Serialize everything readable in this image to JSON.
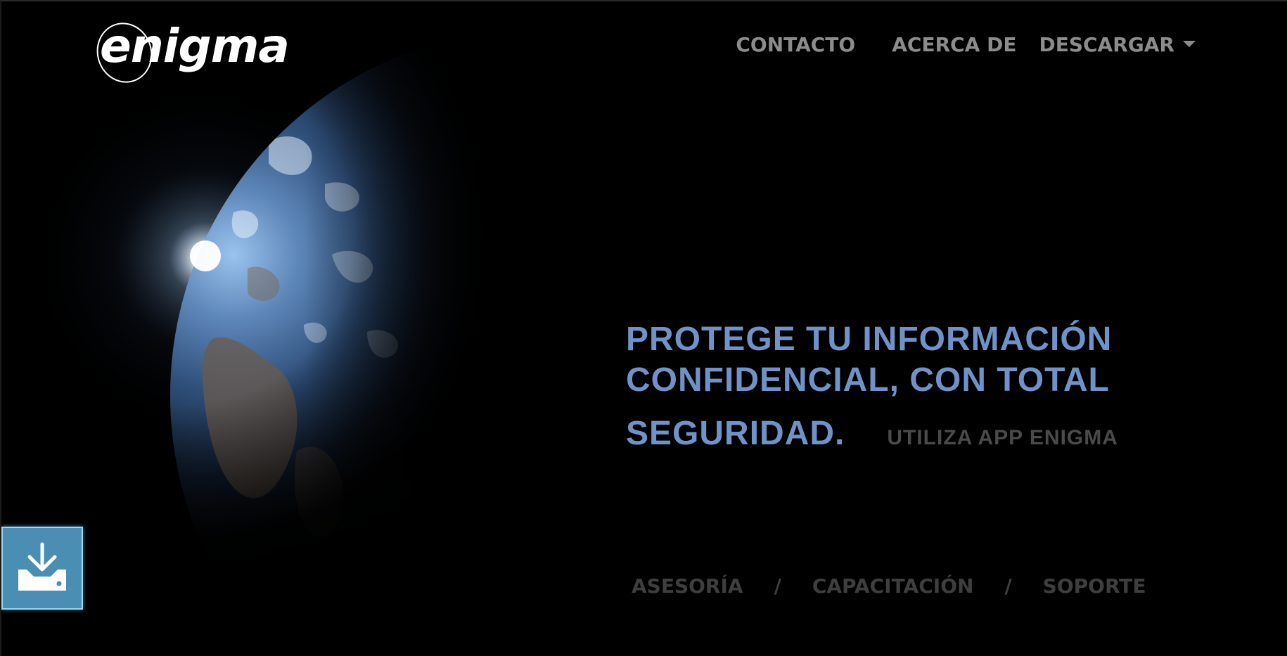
{
  "brand": {
    "logo_text": "enigma"
  },
  "nav": {
    "contacto": "CONTACTO",
    "acerca": "ACERCA DE",
    "descargar": "DESCARGAR"
  },
  "hero": {
    "line1": "PROTEGE TU INFORMACIÓN",
    "line2": "CONFIDENCIAL, CON TOTAL",
    "line3": "SEGURIDAD.",
    "subtitle": "UTILIZA APP ENIGMA"
  },
  "services": {
    "item1": "ASESORÍA",
    "sep1": "/",
    "item2": "CAPACITACIÓN",
    "sep2": "/",
    "item3": "SOPORTE"
  },
  "floating": {
    "icon": "download-icon"
  },
  "colors": {
    "background": "#000000",
    "hero_text": "#6f93c8",
    "nav_text": "#8c8c8c",
    "subtitle_text": "#4a4a4a",
    "services_text": "#3e3e3e",
    "download_button": "#4a8fb3"
  }
}
